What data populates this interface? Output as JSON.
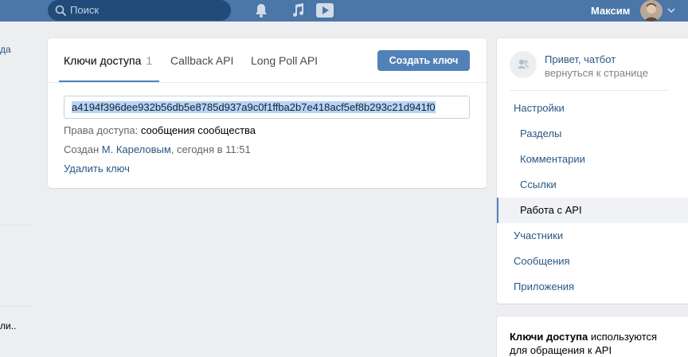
{
  "topbar": {
    "search_placeholder": "Поиск",
    "user_name": "Максим",
    "icons": [
      "search-icon",
      "bell-icon",
      "music-icon",
      "video-icon",
      "chevron-down-icon"
    ]
  },
  "left_strip": {
    "text_top": "да",
    "text_bottom": "ли.."
  },
  "tabs": [
    {
      "label": "Ключи доступа",
      "count": "1"
    },
    {
      "label": "Callback API"
    },
    {
      "label": "Long Poll API"
    }
  ],
  "create_button": "Создать ключ",
  "key": {
    "value": "a4194f396dee932b56db5e8785d937a9c0f1ffba2b7e418acf5ef8b293c21d941f0",
    "rights_label": "Права доступа:",
    "rights_value": "сообщения сообщества",
    "created_prefix": "Создан",
    "created_by": "М. Кареловым",
    "created_suffix": ", сегодня в 11:51",
    "delete_label": "Удалить ключ"
  },
  "right_nav": {
    "greeting_line1": "Привет, чатбот",
    "greeting_line2": "вернуться к странице",
    "items": {
      "settings": "Настройки",
      "sections": "Разделы",
      "comments": "Комментарии",
      "links": "Ссылки",
      "api": "Работа с API",
      "members": "Участники",
      "messages": "Сообщения",
      "apps": "Приложения"
    }
  },
  "info_box": {
    "bold": "Ключи доступа",
    "rest": " используются для обращения к API"
  },
  "colors": {
    "header": "#4a76a8",
    "accent": "#5181b8",
    "link": "#2a5885",
    "background": "#edeef0"
  }
}
